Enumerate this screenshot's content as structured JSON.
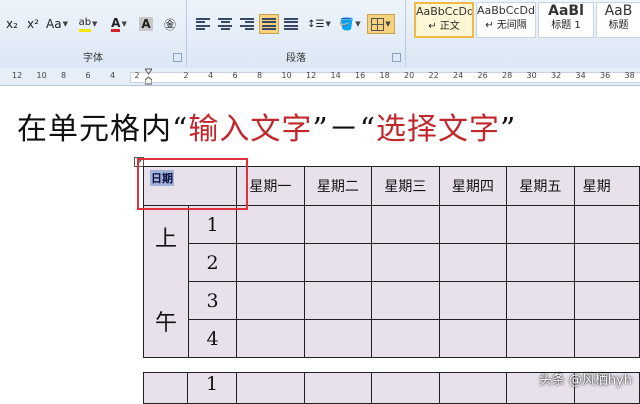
{
  "ribbon": {
    "font_group": {
      "label": "字体",
      "subscript": "x₂",
      "superscript": "x²",
      "change_case": "Aa",
      "highlight": "ab",
      "font_color": "A",
      "char_shading": "A",
      "enclose": "㊎"
    },
    "paragraph_group": {
      "label": "段落"
    },
    "styles_group": {
      "items": [
        {
          "sample": "AaBbCcDd",
          "name": "↵ 正文",
          "selected": true
        },
        {
          "sample": "AaBbCcDd",
          "name": "↵ 无间隔",
          "selected": false
        },
        {
          "sample": "AaBl",
          "name": "标题 1",
          "selected": false
        },
        {
          "sample": "AaB",
          "name": "标题",
          "selected": false
        }
      ]
    },
    "colors": {
      "highlight": "#f5e600",
      "font_color": "#d8232a",
      "accent": "#f0b845"
    }
  },
  "ruler": {
    "ticks": [
      "12",
      "10",
      "8",
      "6",
      "4",
      "2",
      "",
      "2",
      "4",
      "6",
      "8",
      "10",
      "12",
      "14",
      "16",
      "18",
      "20",
      "22",
      "24",
      "26",
      "28",
      "30",
      "32",
      "34",
      "36",
      "38"
    ]
  },
  "document": {
    "heading": {
      "part1": "在单元格内“",
      "part2": "输入文字",
      "part3": "”－“",
      "part4": "选择文字",
      "part5": "”"
    },
    "table": {
      "date_cell": "日期",
      "weekdays": [
        "星期一",
        "星期二",
        "星期三",
        "星期四",
        "星期五",
        "星期"
      ],
      "morning_top": "上",
      "morning_bottom": "午",
      "periods": [
        "1",
        "2",
        "3",
        "4"
      ],
      "next_period": "1"
    }
  },
  "watermark": "头条 @风栖hyh"
}
